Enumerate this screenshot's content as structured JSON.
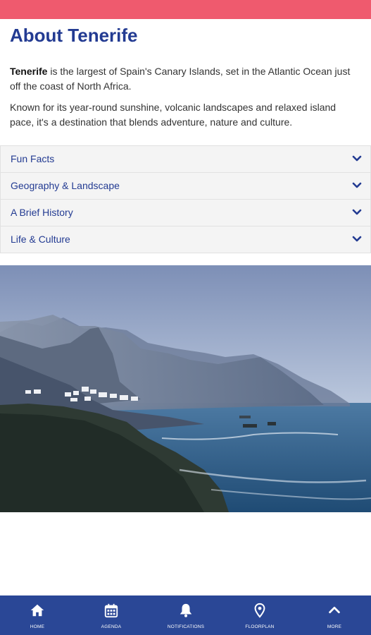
{
  "page": {
    "title": "About Tenerife"
  },
  "intro": {
    "highlight": "Tenerife",
    "p1_rest": " is the largest of Spain's Canary Islands, set in the Atlantic Ocean just off the coast of North Africa.",
    "p2": "Known for its year-round sunshine, volcanic landscapes and relaxed island pace, it's a destination that blends adventure, nature and culture."
  },
  "accordion": [
    {
      "label": "Fun Facts"
    },
    {
      "label": "Geography & Landscape"
    },
    {
      "label": "A Brief History"
    },
    {
      "label": "Life & Culture"
    }
  ],
  "nav": [
    {
      "label": "HOME",
      "icon": "home-icon"
    },
    {
      "label": "AGENDA",
      "icon": "calendar-icon"
    },
    {
      "label": "NOTIFICATIONS",
      "icon": "bell-icon"
    },
    {
      "label": "FLOORPLAN",
      "icon": "map-pin-icon"
    },
    {
      "label": "MORE",
      "icon": "chevron-up-icon"
    }
  ],
  "colors": {
    "accent_top": "#ef5a6e",
    "brand": "#233b92",
    "nav_bg": "#2a4796"
  }
}
